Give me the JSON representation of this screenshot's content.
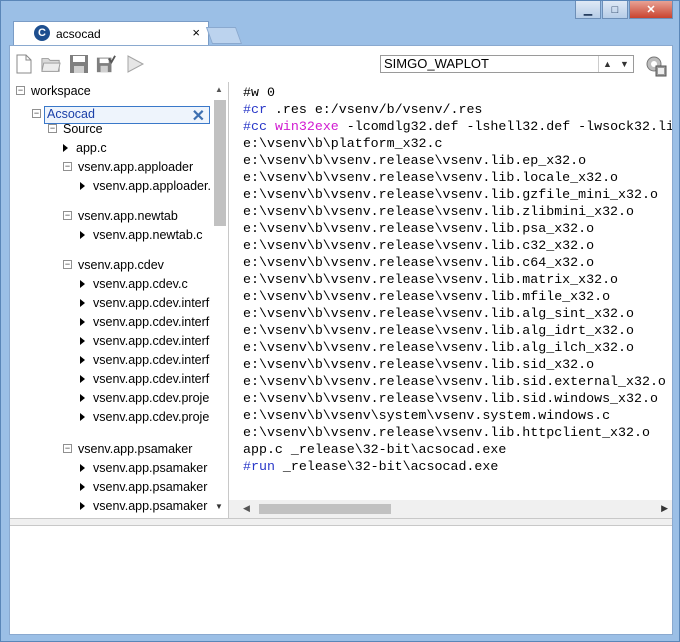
{
  "window": {
    "minimize_glyph": "▁",
    "maximize_glyph": "□",
    "close_glyph": "✕"
  },
  "tab": {
    "logo_glyph": "C",
    "label": "acsocad",
    "close_glyph": "×"
  },
  "toolbar": {
    "target_value": "SIMGO_WAPLOT",
    "icons": [
      "new-file-icon",
      "open-folder-icon",
      "save-icon",
      "save-all-icon",
      "run-icon",
      "build-icon"
    ]
  },
  "tree": {
    "root": "workspace",
    "project": "Acsocad",
    "project_close": "✕",
    "items": [
      {
        "label": "Source",
        "kind": "expander",
        "level": 2
      },
      {
        "label": "app.c",
        "kind": "file",
        "level": 3
      },
      {
        "label": "vsenv.app.apploader",
        "kind": "expander",
        "level": 3
      },
      {
        "label": "vsenv.app.apploader.",
        "kind": "file",
        "level": 4
      },
      {
        "label": "vsenv.app.newtab",
        "kind": "expander",
        "level": 3
      },
      {
        "label": "vsenv.app.newtab.c",
        "kind": "file",
        "level": 4
      },
      {
        "label": "vsenv.app.cdev",
        "kind": "expander",
        "level": 3
      },
      {
        "label": "vsenv.app.cdev.c",
        "kind": "file",
        "level": 4
      },
      {
        "label": "vsenv.app.cdev.interf",
        "kind": "file",
        "level": 4
      },
      {
        "label": "vsenv.app.cdev.interf",
        "kind": "file",
        "level": 4
      },
      {
        "label": "vsenv.app.cdev.interf",
        "kind": "file",
        "level": 4
      },
      {
        "label": "vsenv.app.cdev.interf",
        "kind": "file",
        "level": 4
      },
      {
        "label": "vsenv.app.cdev.interf",
        "kind": "file",
        "level": 4
      },
      {
        "label": "vsenv.app.cdev.proje",
        "kind": "file",
        "level": 4
      },
      {
        "label": "vsenv.app.cdev.proje",
        "kind": "file",
        "level": 4
      },
      {
        "label": "vsenv.app.psamaker",
        "kind": "expander",
        "level": 3
      },
      {
        "label": "vsenv.app.psamaker",
        "kind": "file",
        "level": 4
      },
      {
        "label": "vsenv.app.psamaker",
        "kind": "file",
        "level": 4
      },
      {
        "label": "vsenv.app.psamaker",
        "kind": "file",
        "level": 4
      }
    ]
  },
  "editor": {
    "lines": [
      [
        {
          "t": "#w 0",
          "c": ""
        }
      ],
      [
        {
          "t": "#cr",
          "c": "kw"
        },
        {
          "t": " .res e:/vsenv/b/vsenv/.res",
          "c": ""
        }
      ],
      [
        {
          "t": "#cc",
          "c": "kw"
        },
        {
          "t": " ",
          "c": ""
        },
        {
          "t": "win32exe",
          "c": "kw2"
        },
        {
          "t": " -lcomdlg32.def -lshell32.def -lwsock32.li",
          "c": ""
        }
      ],
      [
        {
          "t": "e:\\vsenv\\b\\platform_x32.c",
          "c": ""
        }
      ],
      [
        {
          "t": "e:\\vsenv\\b\\vsenv.release\\vsenv.lib.ep_x32.o",
          "c": ""
        }
      ],
      [
        {
          "t": "e:\\vsenv\\b\\vsenv.release\\vsenv.lib.locale_x32.o",
          "c": ""
        }
      ],
      [
        {
          "t": "e:\\vsenv\\b\\vsenv.release\\vsenv.lib.gzfile_mini_x32.o",
          "c": ""
        }
      ],
      [
        {
          "t": "e:\\vsenv\\b\\vsenv.release\\vsenv.lib.zlibmini_x32.o",
          "c": ""
        }
      ],
      [
        {
          "t": "e:\\vsenv\\b\\vsenv.release\\vsenv.lib.psa_x32.o",
          "c": ""
        }
      ],
      [
        {
          "t": "e:\\vsenv\\b\\vsenv.release\\vsenv.lib.c32_x32.o",
          "c": ""
        }
      ],
      [
        {
          "t": "e:\\vsenv\\b\\vsenv.release\\vsenv.lib.c64_x32.o",
          "c": ""
        }
      ],
      [
        {
          "t": "e:\\vsenv\\b\\vsenv.release\\vsenv.lib.matrix_x32.o",
          "c": ""
        }
      ],
      [
        {
          "t": "e:\\vsenv\\b\\vsenv.release\\vsenv.lib.mfile_x32.o",
          "c": ""
        }
      ],
      [
        {
          "t": "e:\\vsenv\\b\\vsenv.release\\vsenv.lib.alg_sint_x32.o",
          "c": ""
        }
      ],
      [
        {
          "t": "e:\\vsenv\\b\\vsenv.release\\vsenv.lib.alg_idrt_x32.o",
          "c": ""
        }
      ],
      [
        {
          "t": "e:\\vsenv\\b\\vsenv.release\\vsenv.lib.alg_ilch_x32.o",
          "c": ""
        }
      ],
      [
        {
          "t": "e:\\vsenv\\b\\vsenv.release\\vsenv.lib.sid_x32.o",
          "c": ""
        }
      ],
      [
        {
          "t": "e:\\vsenv\\b\\vsenv.release\\vsenv.lib.sid.external_x32.o",
          "c": ""
        }
      ],
      [
        {
          "t": "e:\\vsenv\\b\\vsenv.release\\vsenv.lib.sid.windows_x32.o",
          "c": ""
        }
      ],
      [
        {
          "t": "e:\\vsenv\\b\\vsenv\\system\\vsenv.system.windows.c",
          "c": ""
        }
      ],
      [
        {
          "t": "e:\\vsenv\\b\\vsenv.release\\vsenv.lib.httpclient_x32.o",
          "c": ""
        }
      ],
      [
        {
          "t": "app.c _release\\32-bit\\acsocad.exe",
          "c": ""
        }
      ],
      [
        {
          "t": "#run",
          "c": "kw"
        },
        {
          "t": " _release\\32-bit\\acsocad.exe",
          "c": ""
        }
      ]
    ]
  }
}
